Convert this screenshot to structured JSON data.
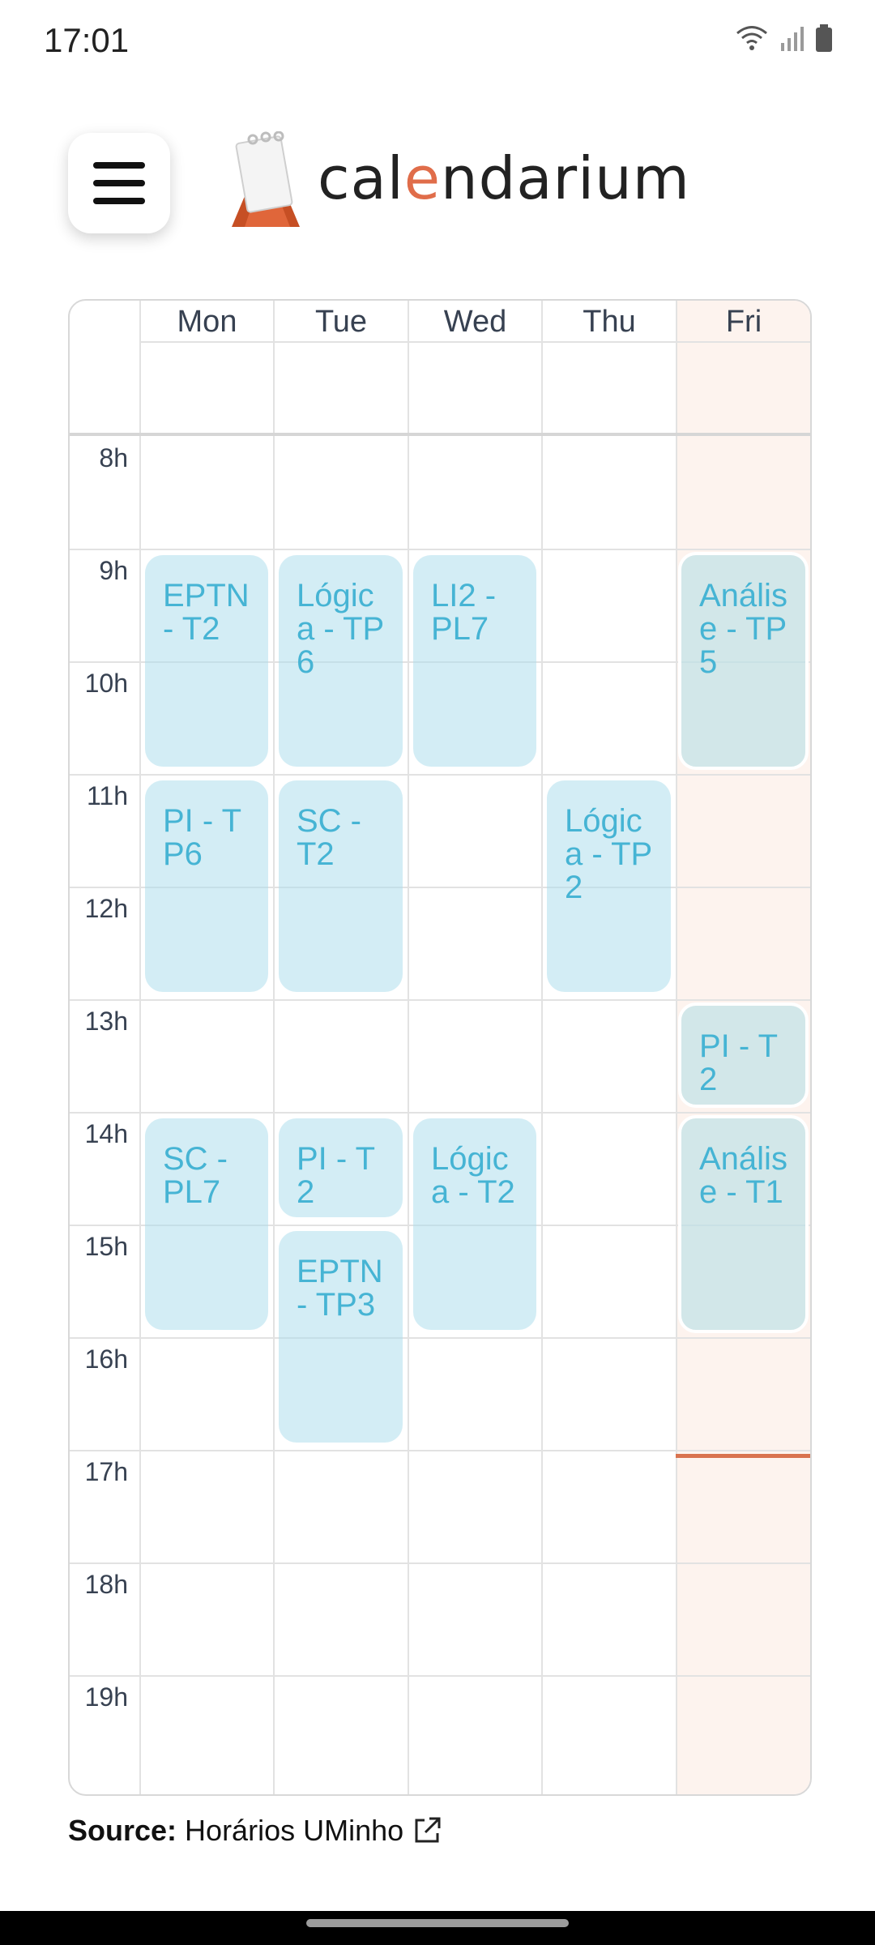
{
  "status_bar": {
    "time": "17:01"
  },
  "app": {
    "brand_prefix": "cal",
    "brand_accent": "e",
    "brand_suffix": "ndarium",
    "accent_color": "#e06d4a"
  },
  "calendar": {
    "days": [
      "Mon",
      "Tue",
      "Wed",
      "Thu",
      "Fri"
    ],
    "current_day": "Fri",
    "hours": [
      "8h",
      "9h",
      "10h",
      "11h",
      "12h",
      "13h",
      "14h",
      "15h",
      "16h",
      "17h",
      "18h",
      "19h"
    ],
    "events": {
      "mon": [
        "EPTN - T2",
        "PI - TP6",
        "SC - PL7"
      ],
      "tue": [
        "Lógica - TP6",
        "SC - T2",
        "PI - T2",
        "EPTN - TP3"
      ],
      "wed": [
        "LI2 - PL7",
        "Lógica - T2"
      ],
      "thu": [
        "Lógica - TP2"
      ],
      "fri": [
        "Análise - TP5",
        "PI - T2",
        "Análise - T1"
      ]
    }
  },
  "footer": {
    "source_label": "Source:",
    "source_link": "Horários UMinho"
  }
}
